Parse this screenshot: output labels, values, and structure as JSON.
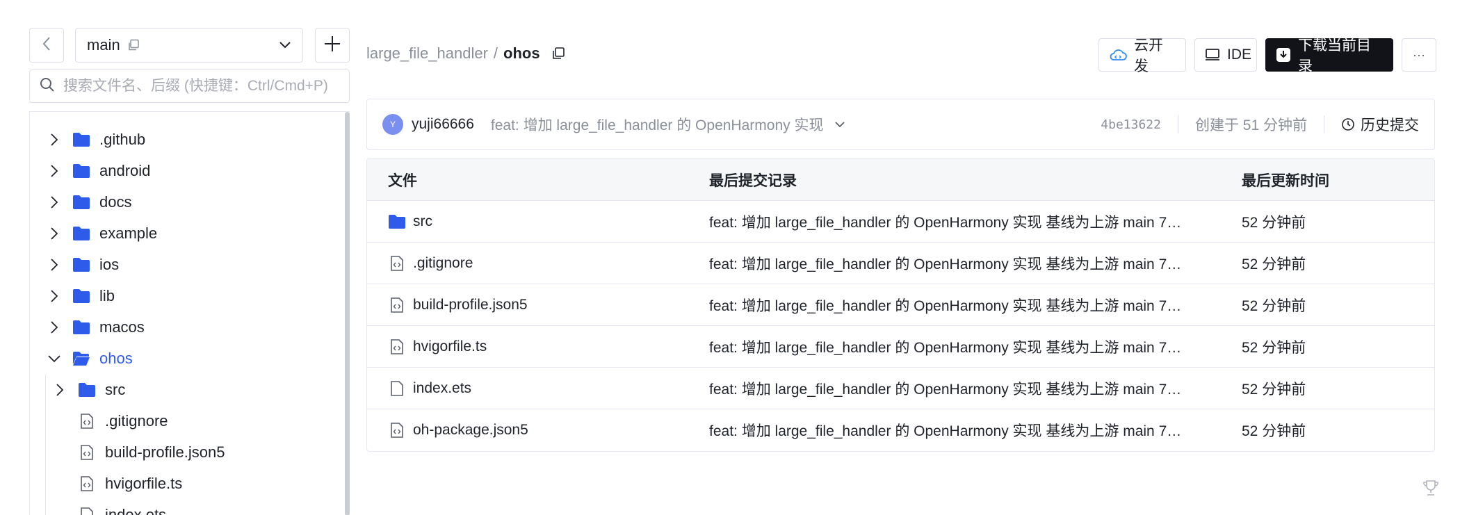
{
  "branch": {
    "name": "main"
  },
  "search": {
    "placeholder": "搜索文件名、后缀 (快捷键：Ctrl/Cmd+P)"
  },
  "tree": {
    "items": [
      {
        "label": ".github",
        "type": "folder",
        "expanded": false
      },
      {
        "label": "android",
        "type": "folder",
        "expanded": false
      },
      {
        "label": "docs",
        "type": "folder",
        "expanded": false
      },
      {
        "label": "example",
        "type": "folder",
        "expanded": false
      },
      {
        "label": "ios",
        "type": "folder",
        "expanded": false
      },
      {
        "label": "lib",
        "type": "folder",
        "expanded": false
      },
      {
        "label": "macos",
        "type": "folder",
        "expanded": false
      },
      {
        "label": "ohos",
        "type": "folder",
        "expanded": true,
        "active": true
      },
      {
        "label": "src",
        "type": "folder",
        "expanded": false
      },
      {
        "label": ".gitignore",
        "type": "code"
      },
      {
        "label": "build-profile.json5",
        "type": "code"
      },
      {
        "label": "hvigorfile.ts",
        "type": "code"
      },
      {
        "label": "index.ets",
        "type": "file"
      }
    ]
  },
  "breadcrumb": {
    "root": "large_file_handler",
    "separator": "/",
    "current": "ohos"
  },
  "header": {
    "cloud_label": "云开发",
    "ide_label": "IDE",
    "download_label": "下载当前目录",
    "more_label": "···"
  },
  "commit": {
    "avatar_letter": "Y",
    "author": "yuji66666",
    "message": "feat: 增加 large_file_handler 的 OpenHarmony 实现",
    "hash": "4be13622",
    "time": "创建于 51 分钟前",
    "history_label": "历史提交"
  },
  "table": {
    "headers": {
      "file": "文件",
      "commit": "最后提交记录",
      "updated": "最后更新时间"
    },
    "rows": [
      {
        "name": "src",
        "type": "folder",
        "message": "feat: 增加 large_file_handler 的 OpenHarmony 实现 基线为上游 main 7…",
        "time": "52 分钟前"
      },
      {
        "name": ".gitignore",
        "type": "code",
        "message": "feat: 增加 large_file_handler 的 OpenHarmony 实现 基线为上游 main 7…",
        "time": "52 分钟前"
      },
      {
        "name": "build-profile.json5",
        "type": "code",
        "message": "feat: 增加 large_file_handler 的 OpenHarmony 实现 基线为上游 main 7…",
        "time": "52 分钟前"
      },
      {
        "name": "hvigorfile.ts",
        "type": "code",
        "message": "feat: 增加 large_file_handler 的 OpenHarmony 实现 基线为上游 main 7…",
        "time": "52 分钟前"
      },
      {
        "name": "index.ets",
        "type": "file",
        "message": "feat: 增加 large_file_handler 的 OpenHarmony 实现 基线为上游 main 7…",
        "time": "52 分钟前"
      },
      {
        "name": "oh-package.json5",
        "type": "code",
        "message": "feat: 增加 large_file_handler 的 OpenHarmony 实现 基线为上游 main 7…",
        "time": "52 分钟前"
      }
    ]
  },
  "colors": {
    "accent": "#2f5bea",
    "folder": "#2f5bea",
    "download_bg": "#111318",
    "muted": "#8a8f99"
  },
  "icons": [
    "chevron-left-icon",
    "copy-icon",
    "chevron-down-icon",
    "plus-icon",
    "search-icon",
    "chevron-right-icon",
    "folder-icon",
    "folder-open-icon",
    "code-file-icon",
    "file-icon",
    "cloud-icon",
    "ide-icon",
    "download-icon",
    "more-icon",
    "clock-icon",
    "trophy-icon"
  ]
}
